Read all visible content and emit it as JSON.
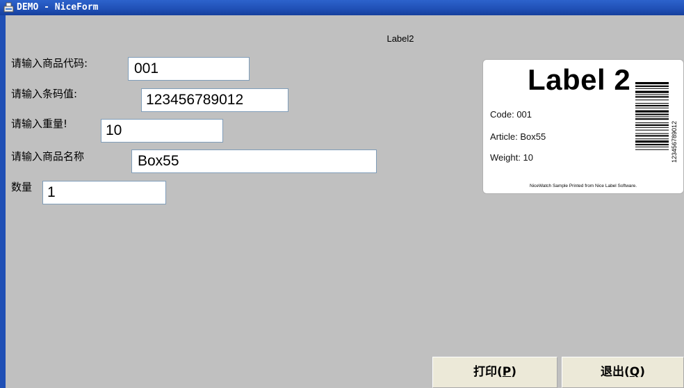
{
  "window": {
    "title": "DEMO - NiceForm",
    "icon": "niceform-app-icon"
  },
  "form": {
    "caption": "Label2",
    "fields": [
      {
        "label": "请输入商品代码:",
        "value": "001"
      },
      {
        "label": "请输入条码值:",
        "value": "123456789012"
      },
      {
        "label": "请输入重量!",
        "value": "10"
      },
      {
        "label": "请输入商品名称",
        "value": "Box55"
      },
      {
        "label": "数量",
        "value": "1"
      }
    ]
  },
  "preview": {
    "title": "Label 2",
    "rows": [
      {
        "key": "Code:",
        "value": "001"
      },
      {
        "key": "Article:",
        "value": "Box55"
      },
      {
        "key": "Weight:",
        "value": "10"
      }
    ],
    "barcode_text": "123456789012",
    "footer": "NiceWatch Sample Printed from Nice Label Software."
  },
  "buttons": {
    "print": {
      "text": "打印(",
      "key": "P",
      "close": ")"
    },
    "exit": {
      "text": "退出(",
      "key": "Q",
      "close": ")"
    }
  },
  "colors": {
    "titlebar": "#1f4fb5",
    "background": "#c0c0c0",
    "button_face": "#ece9d8"
  }
}
